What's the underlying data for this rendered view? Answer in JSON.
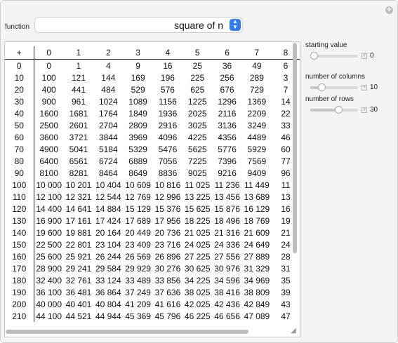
{
  "function_control": {
    "label": "function",
    "value": "square of n"
  },
  "controls": [
    {
      "label": "starting value",
      "value": "0",
      "level": 0.0
    },
    {
      "label": "number of columns",
      "value": "10",
      "level": 0.2
    },
    {
      "label": "number of rows",
      "value": "30",
      "level": 0.62
    }
  ],
  "table": {
    "corner": "+",
    "columns": [
      "0",
      "1",
      "2",
      "3",
      "4",
      "5",
      "6",
      "7",
      "8"
    ],
    "rows": [
      {
        "head": "0",
        "cells": [
          "0",
          "1",
          "4",
          "9",
          "16",
          "25",
          "36",
          "49",
          "6"
        ]
      },
      {
        "head": "10",
        "cells": [
          "100",
          "121",
          "144",
          "169",
          "196",
          "225",
          "256",
          "289",
          "3"
        ]
      },
      {
        "head": "20",
        "cells": [
          "400",
          "441",
          "484",
          "529",
          "576",
          "625",
          "676",
          "729",
          "7"
        ]
      },
      {
        "head": "30",
        "cells": [
          "900",
          "961",
          "1024",
          "1089",
          "1156",
          "1225",
          "1296",
          "1369",
          "14"
        ]
      },
      {
        "head": "40",
        "cells": [
          "1600",
          "1681",
          "1764",
          "1849",
          "1936",
          "2025",
          "2116",
          "2209",
          "22"
        ]
      },
      {
        "head": "50",
        "cells": [
          "2500",
          "2601",
          "2704",
          "2809",
          "2916",
          "3025",
          "3136",
          "3249",
          "33"
        ]
      },
      {
        "head": "60",
        "cells": [
          "3600",
          "3721",
          "3844",
          "3969",
          "4096",
          "4225",
          "4356",
          "4489",
          "46"
        ]
      },
      {
        "head": "70",
        "cells": [
          "4900",
          "5041",
          "5184",
          "5329",
          "5476",
          "5625",
          "5776",
          "5929",
          "60"
        ]
      },
      {
        "head": "80",
        "cells": [
          "6400",
          "6561",
          "6724",
          "6889",
          "7056",
          "7225",
          "7396",
          "7569",
          "77"
        ]
      },
      {
        "head": "90",
        "cells": [
          "8100",
          "8281",
          "8464",
          "8649",
          "8836",
          "9025",
          "9216",
          "9409",
          "96"
        ]
      },
      {
        "head": "100",
        "cells": [
          "10 000",
          "10 201",
          "10 404",
          "10 609",
          "10 816",
          "11 025",
          "11 236",
          "11 449",
          "11"
        ]
      },
      {
        "head": "110",
        "cells": [
          "12 100",
          "12 321",
          "12 544",
          "12 769",
          "12 996",
          "13 225",
          "13 456",
          "13 689",
          "13"
        ]
      },
      {
        "head": "120",
        "cells": [
          "14 400",
          "14 641",
          "14 884",
          "15 129",
          "15 376",
          "15 625",
          "15 876",
          "16 129",
          "16"
        ]
      },
      {
        "head": "130",
        "cells": [
          "16 900",
          "17 161",
          "17 424",
          "17 689",
          "17 956",
          "18 225",
          "18 496",
          "18 769",
          "19"
        ]
      },
      {
        "head": "140",
        "cells": [
          "19 600",
          "19 881",
          "20 164",
          "20 449",
          "20 736",
          "21 025",
          "21 316",
          "21 609",
          "21"
        ]
      },
      {
        "head": "150",
        "cells": [
          "22 500",
          "22 801",
          "23 104",
          "23 409",
          "23 716",
          "24 025",
          "24 336",
          "24 649",
          "24"
        ]
      },
      {
        "head": "160",
        "cells": [
          "25 600",
          "25 921",
          "26 244",
          "26 569",
          "26 896",
          "27 225",
          "27 556",
          "27 889",
          "28"
        ]
      },
      {
        "head": "170",
        "cells": [
          "28 900",
          "29 241",
          "29 584",
          "29 929",
          "30 276",
          "30 625",
          "30 976",
          "31 329",
          "31"
        ]
      },
      {
        "head": "180",
        "cells": [
          "32 400",
          "32 761",
          "33 124",
          "33 489",
          "33 856",
          "34 225",
          "34 596",
          "34 969",
          "35"
        ]
      },
      {
        "head": "190",
        "cells": [
          "36 100",
          "36 481",
          "36 864",
          "37 249",
          "37 636",
          "38 025",
          "38 416",
          "38 809",
          "39"
        ]
      },
      {
        "head": "200",
        "cells": [
          "40 000",
          "40 401",
          "40 804",
          "41 209",
          "41 616",
          "42 025",
          "42 436",
          "42 849",
          "43"
        ]
      },
      {
        "head": "210",
        "cells": [
          "44 100",
          "44 521",
          "44 944",
          "45 369",
          "45 796",
          "46 225",
          "46 656",
          "47 089",
          "47"
        ]
      }
    ]
  }
}
